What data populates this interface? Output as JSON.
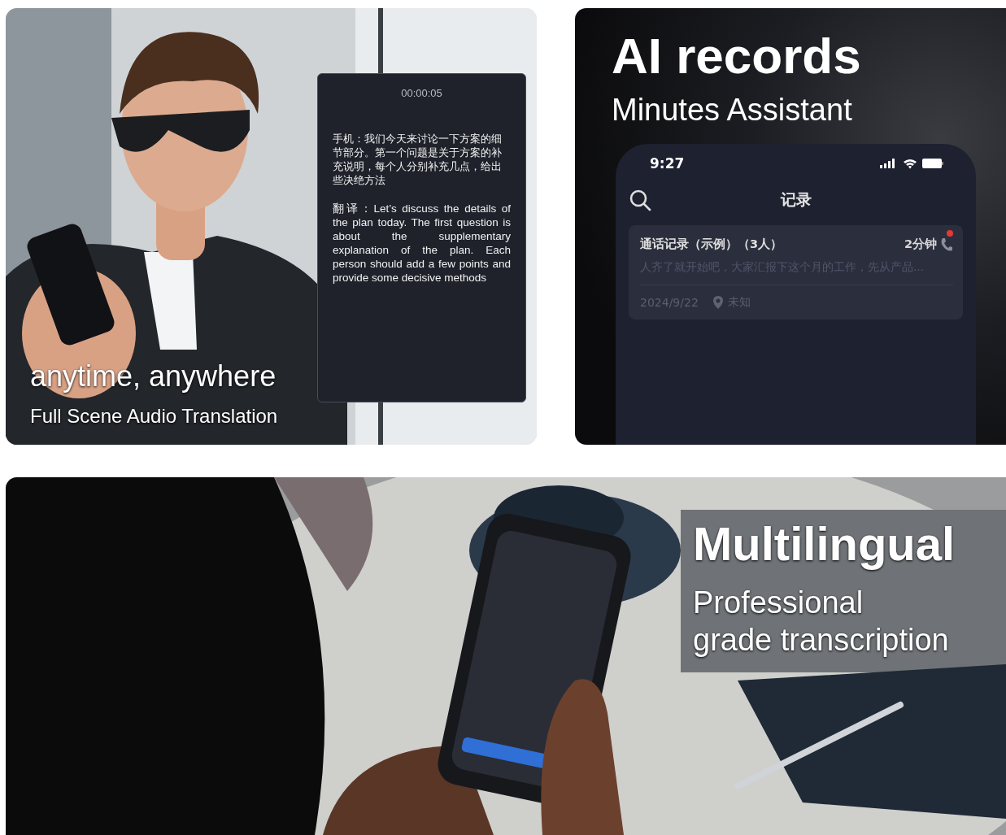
{
  "translation_panel": {
    "timer": "00:00:05",
    "source_text": "手机：我们今天来讨论一下方案的细节部分。第一个问题是关于方案的补充说明，每个人分别补充几点，给出些决绝方法",
    "translation_text": "翻译：Let’s discuss the details of the plan today. The first question is about the supplementary explanation of the plan. Each person should add a few points and provide some decisive methods",
    "headline": "anytime, anywhere",
    "subheadline": "Full Scene Audio Translation"
  },
  "records_panel": {
    "headline": "AI records",
    "subheadline": "Minutes Assistant",
    "phone": {
      "time": "9:27",
      "title": "记录",
      "record": {
        "title": "通话记录（示例）（3人）",
        "duration": "2分钟",
        "unread": true,
        "preview": "人齐了就开始吧，大家汇报下这个月的工作，先从产品...",
        "date": "2024/9/22",
        "location": "未知"
      }
    }
  },
  "transcription_panel": {
    "headline": "Multilingual",
    "subheadline_lines": [
      "Professional",
      "grade transcription"
    ]
  }
}
